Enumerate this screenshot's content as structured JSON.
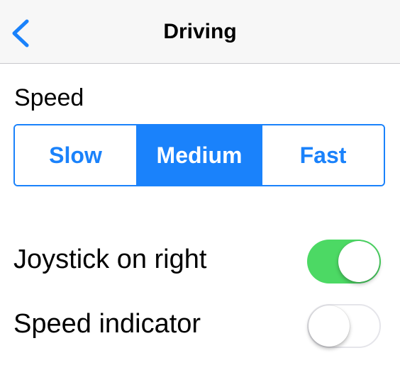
{
  "navbar": {
    "title": "Driving",
    "back_icon": "chevron-left-icon"
  },
  "speed": {
    "label": "Speed",
    "options": [
      "Slow",
      "Medium",
      "Fast"
    ],
    "selected": "Medium"
  },
  "settings": [
    {
      "label": "Joystick on right",
      "enabled": true
    },
    {
      "label": "Speed indicator",
      "enabled": false
    }
  ],
  "colors": {
    "accent": "#1a82fb",
    "toggle_on": "#4cd964",
    "navbar_bg": "#f7f7f7",
    "toggle_off_border": "#e5e5ea"
  }
}
